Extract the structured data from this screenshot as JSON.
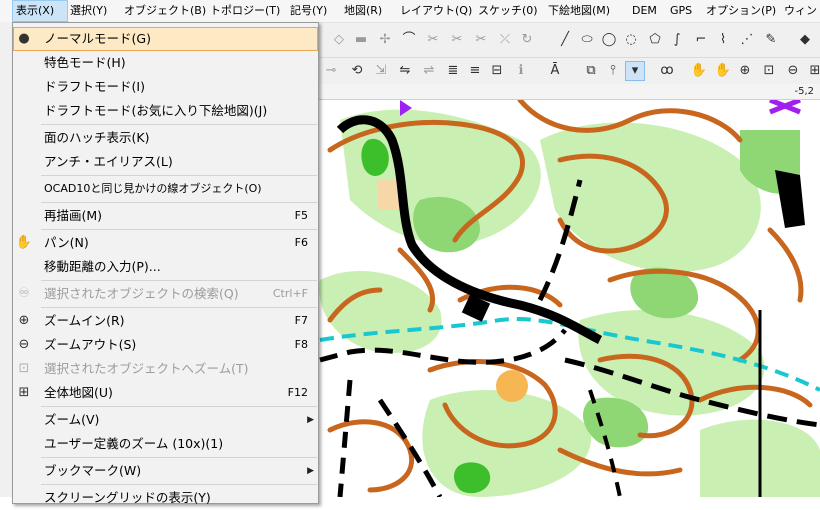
{
  "menubar": {
    "items": [
      {
        "label": "表示(X)"
      },
      {
        "label": "選択(Y)"
      },
      {
        "label": "オブジェクト(B)"
      },
      {
        "label": "トポロジー(T)"
      },
      {
        "label": "記号(Y)"
      },
      {
        "label": "地図(R)"
      },
      {
        "label": "レイアウト(Q)"
      },
      {
        "label": "スケッチ(0)"
      },
      {
        "label": "下絵地図(M)"
      },
      {
        "label": "DEM"
      },
      {
        "label": "GPS"
      },
      {
        "label": "オプション(P)"
      },
      {
        "label": "ウィンド"
      }
    ]
  },
  "status": {
    "coordinate": "-5,2"
  },
  "view_menu": {
    "items": [
      {
        "label": "ノーマルモード(G)",
        "shortcut": "",
        "icon": "radio-dot",
        "glyph": "●"
      },
      {
        "label": "特色モード(H)",
        "shortcut": ""
      },
      {
        "label": "ドラフトモード(I)",
        "shortcut": ""
      },
      {
        "label": "ドラフトモード(お気に入り下絵地図)(J)",
        "shortcut": ""
      },
      {
        "label": "面のハッチ表示(K)",
        "shortcut": ""
      },
      {
        "label": "アンチ・エイリアス(L)",
        "shortcut": ""
      },
      {
        "label": "OCAD10と同じ見かけの線オブジェクト(O)",
        "shortcut": ""
      },
      {
        "label": "再描画(M)",
        "shortcut": "F5"
      },
      {
        "label": "パン(N)",
        "shortcut": "F6",
        "icon": "hand-icon",
        "glyph": "✋"
      },
      {
        "label": "移動距離の入力(P)...",
        "shortcut": ""
      },
      {
        "label": "選択されたオブジェクトの検索(Q)",
        "shortcut": "Ctrl+F",
        "icon": "binoculars-icon",
        "glyph": "♾"
      },
      {
        "label": "ズームイン(R)",
        "shortcut": "F7",
        "icon": "zoom-in-icon",
        "glyph": "⊕"
      },
      {
        "label": "ズームアウト(S)",
        "shortcut": "F8",
        "icon": "zoom-out-icon",
        "glyph": "⊖"
      },
      {
        "label": "選択されたオブジェクトへズーム(T)",
        "shortcut": "",
        "icon": "zoom-selected-icon",
        "glyph": "⊡"
      },
      {
        "label": "全体地図(U)",
        "shortcut": "F12",
        "icon": "zoom-full-icon",
        "glyph": "⊞"
      },
      {
        "label": "ズーム(V)",
        "shortcut": "",
        "submenu": "▶"
      },
      {
        "label": "ユーザー定義のズーム (10x)(1)",
        "shortcut": ""
      },
      {
        "label": "ブックマーク(W)",
        "shortcut": "",
        "submenu": "▶"
      },
      {
        "label": "スクリーングリッドの表示(Y)",
        "shortcut": ""
      }
    ]
  },
  "colors": {
    "contour": "#c8661e",
    "green_light": "#c9f0b2",
    "green_mid": "#8fd675",
    "green_dark": "#3cbf2a",
    "water": "#18c7cf",
    "road": "#000000",
    "purple": "#a020f0",
    "highlight": "#fde9c4",
    "yellow_dot": "#f7b654"
  }
}
